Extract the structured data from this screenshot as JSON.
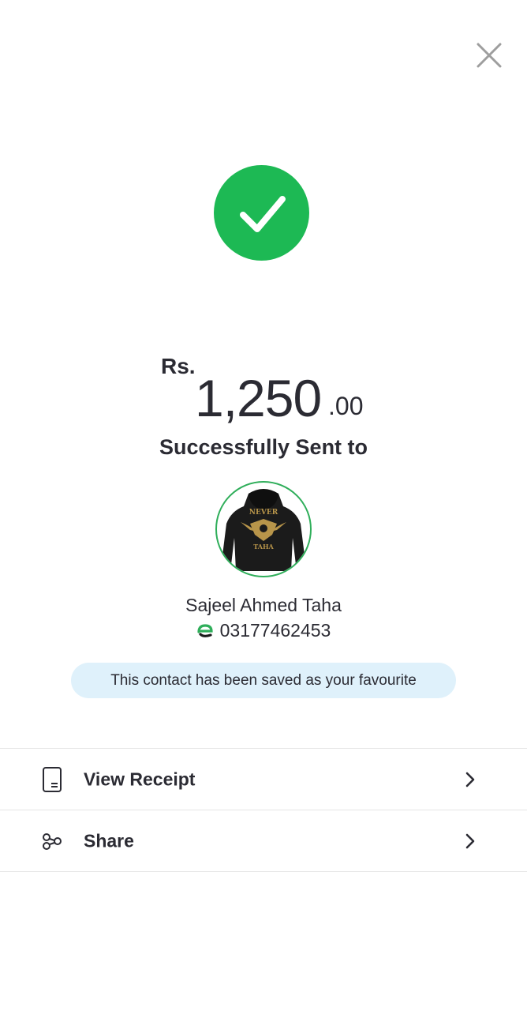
{
  "header": {
    "close_icon": "close-icon"
  },
  "status": {
    "icon": "check-icon",
    "color": "#1db954"
  },
  "amount": {
    "currency": "Rs.",
    "whole": "1,250",
    "decimal": ".00"
  },
  "sent_label": "Successfully Sent to",
  "recipient": {
    "avatar_icon": "avatar-hoodie",
    "avatar_text_top": "NEVER",
    "avatar_text_bottom": "TAHA",
    "name": "Sajeel Ahmed Taha",
    "phone_icon": "easypaisa-icon",
    "phone": "03177462453"
  },
  "favourite_banner": "This contact has been saved as your favourite",
  "actions": [
    {
      "label": "View Receipt",
      "icon": "receipt-icon"
    },
    {
      "label": "Share",
      "icon": "share-icon"
    }
  ],
  "colors": {
    "accent": "#1db954",
    "banner_bg": "#dff1fb",
    "avatar_border": "#2fae5a"
  }
}
